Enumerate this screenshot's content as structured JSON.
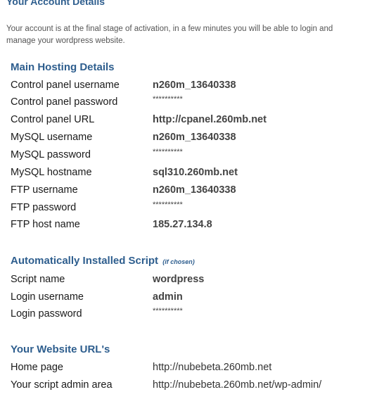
{
  "page": {
    "title": "Your Account Details",
    "intro": "Your account is at the final stage of activation, in a few minutes you will be able to login and manage your wordpress website."
  },
  "hosting": {
    "title": "Main Hosting Details",
    "rows": [
      {
        "label": "Control panel username",
        "value": "n260m_13640338"
      },
      {
        "label": "Control panel password",
        "value": "**********"
      },
      {
        "label": "Control panel URL",
        "value": "http://cpanel.260mb.net"
      },
      {
        "label": "MySQL username",
        "value": "n260m_13640338"
      },
      {
        "label": "MySQL password",
        "value": "**********"
      },
      {
        "label": "MySQL hostname",
        "value": "sql310.260mb.net"
      },
      {
        "label": "FTP username",
        "value": "n260m_13640338"
      },
      {
        "label": "FTP password",
        "value": "**********"
      },
      {
        "label": "FTP host name",
        "value": "185.27.134.8"
      }
    ]
  },
  "script": {
    "title": "Automatically Installed Script",
    "note": "(if chosen)",
    "rows": [
      {
        "label": "Script name",
        "value": "wordpress"
      },
      {
        "label": "Login username",
        "value": "admin"
      },
      {
        "label": "Login password",
        "value": "**********"
      }
    ]
  },
  "urls": {
    "title": "Your Website URL's",
    "rows": [
      {
        "label": "Home page",
        "value": "http://nubebeta.260mb.net"
      },
      {
        "label": "Your script admin area",
        "value": "http://nubebeta.260mb.net/wp-admin/"
      }
    ]
  }
}
